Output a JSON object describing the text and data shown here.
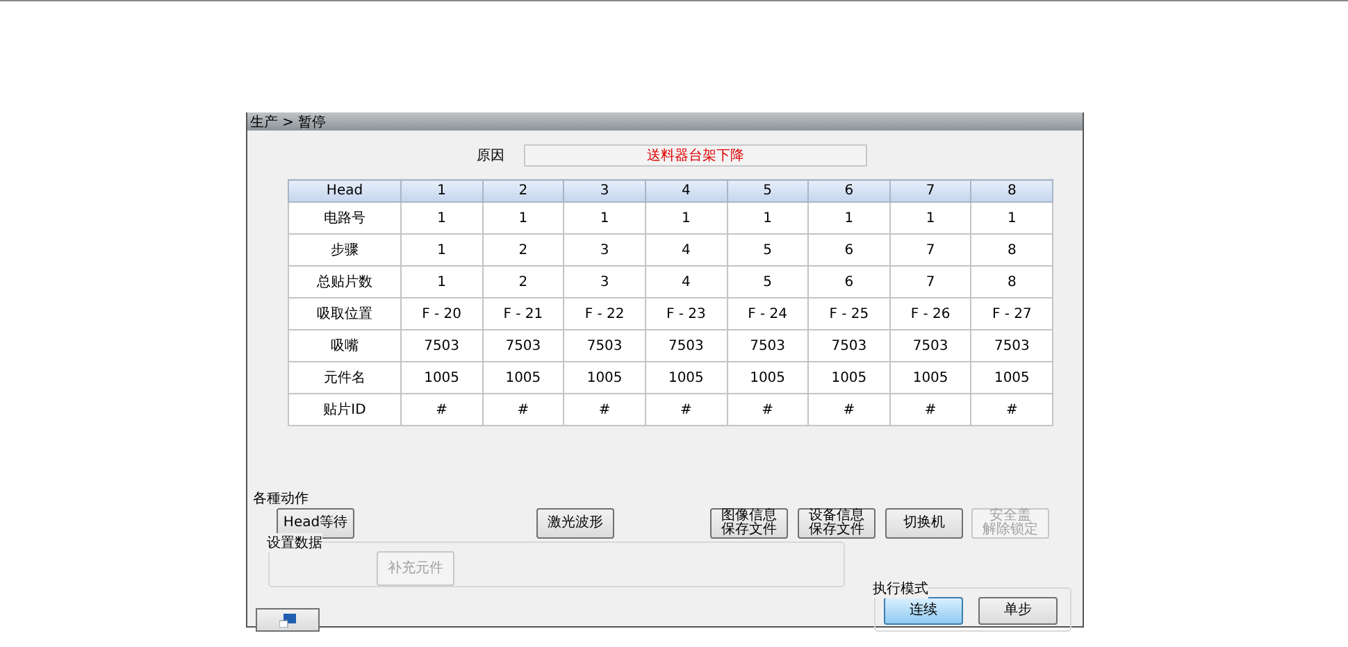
{
  "window": {
    "breadcrumb": "生产 > 暂停"
  },
  "reason": {
    "label": "原因",
    "value": "送料器台架下降"
  },
  "table": {
    "columns": [
      "Head",
      "1",
      "2",
      "3",
      "4",
      "5",
      "6",
      "7",
      "8"
    ],
    "rows": [
      [
        "电路号",
        "1",
        "1",
        "1",
        "1",
        "1",
        "1",
        "1",
        "1"
      ],
      [
        "步骤",
        "1",
        "2",
        "3",
        "4",
        "5",
        "6",
        "7",
        "8"
      ],
      [
        "总贴片数",
        "1",
        "2",
        "3",
        "4",
        "5",
        "6",
        "7",
        "8"
      ],
      [
        "吸取位置",
        "F - 20",
        "F - 21",
        "F - 22",
        "F - 23",
        "F - 24",
        "F - 25",
        "F - 26",
        "F - 27"
      ],
      [
        "吸嘴",
        "7503",
        "7503",
        "7503",
        "7503",
        "7503",
        "7503",
        "7503",
        "7503"
      ],
      [
        "元件名",
        "1005",
        "1005",
        "1005",
        "1005",
        "1005",
        "1005",
        "1005",
        "1005"
      ],
      [
        "贴片ID",
        "#",
        "#",
        "#",
        "#",
        "#",
        "#",
        "#",
        "#"
      ]
    ]
  },
  "actions": {
    "title": "各種动作",
    "buttons": [
      {
        "lines": [
          "Head等待"
        ],
        "disabled": false
      },
      {
        "lines": [
          "激光波形"
        ],
        "disabled": false
      },
      {
        "lines": [
          "图像信息",
          "保存文件"
        ],
        "disabled": false
      },
      {
        "lines": [
          "设备信息",
          "保存文件"
        ],
        "disabled": false
      },
      {
        "lines": [
          "切换机"
        ],
        "disabled": false
      },
      {
        "lines": [
          "安全盖",
          "解除锁定"
        ],
        "disabled": true
      }
    ]
  },
  "settings": {
    "title": "设置数据",
    "buttons": [
      {
        "lines": [
          "补充元件"
        ],
        "disabled": true
      }
    ]
  },
  "mode": {
    "title": "执行模式",
    "options": [
      {
        "label": "连续",
        "selected": true
      },
      {
        "label": "单步",
        "selected": false
      }
    ]
  }
}
